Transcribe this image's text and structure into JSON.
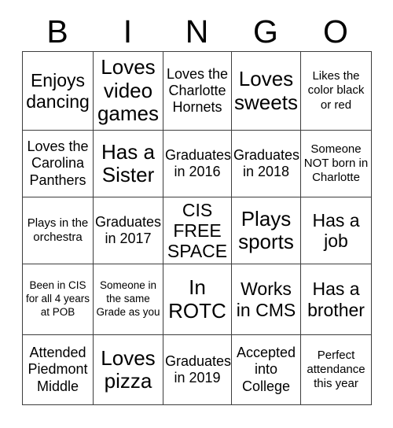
{
  "header": {
    "letters": [
      "B",
      "I",
      "N",
      "G",
      "O"
    ]
  },
  "grid": {
    "rows": [
      [
        {
          "text": "Enjoys dancing",
          "size": "sz-lg"
        },
        {
          "text": "Loves video games",
          "size": "sz-xl"
        },
        {
          "text": "Loves the Charlotte Hornets",
          "size": "sz-md"
        },
        {
          "text": "Loves sweets",
          "size": "sz-xl"
        },
        {
          "text": "Likes the color black or red",
          "size": "sz-sm"
        }
      ],
      [
        {
          "text": "Loves the Carolina Panthers",
          "size": "sz-md"
        },
        {
          "text": "Has a Sister",
          "size": "sz-xl"
        },
        {
          "text": "Graduates in 2016",
          "size": "sz-md"
        },
        {
          "text": "Graduates in 2018",
          "size": "sz-md"
        },
        {
          "text": "Someone NOT born in Charlotte",
          "size": "sz-sm"
        }
      ],
      [
        {
          "text": "Plays in the orchestra",
          "size": "sz-sm"
        },
        {
          "text": "Graduates in 2017",
          "size": "sz-md"
        },
        {
          "text": "CIS FREE SPACE",
          "size": "sz-lg"
        },
        {
          "text": "Plays sports",
          "size": "sz-xl"
        },
        {
          "text": "Has a job",
          "size": "sz-lg"
        }
      ],
      [
        {
          "text": "Been in CIS for all 4 years at POB",
          "size": "sz-xs"
        },
        {
          "text": "Someone in the same Grade as you",
          "size": "sz-xs"
        },
        {
          "text": "In ROTC",
          "size": "sz-xl"
        },
        {
          "text": "Works in CMS",
          "size": "sz-lg"
        },
        {
          "text": "Has a brother",
          "size": "sz-lg"
        }
      ],
      [
        {
          "text": "Attended Piedmont Middle",
          "size": "sz-md"
        },
        {
          "text": "Loves pizza",
          "size": "sz-xl"
        },
        {
          "text": "Graduates in 2019",
          "size": "sz-md"
        },
        {
          "text": "Accepted into College",
          "size": "sz-md"
        },
        {
          "text": "Perfect attendance this year",
          "size": "sz-sm"
        }
      ]
    ]
  }
}
